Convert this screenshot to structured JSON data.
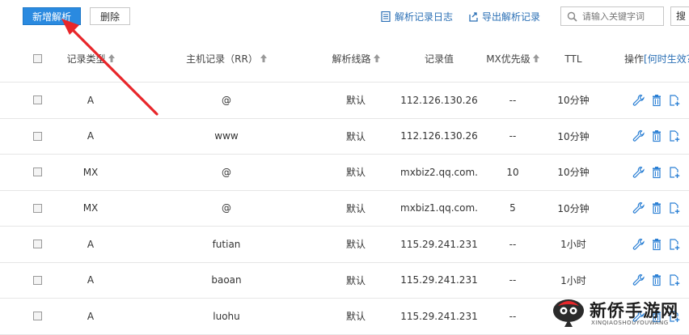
{
  "toolbar": {
    "add_label": "新增解析",
    "delete_label": "删除",
    "log_label": "解析记录日志",
    "export_label": "导出解析记录",
    "search_placeholder": "请输入关键字词",
    "search_button_label": "搜"
  },
  "table": {
    "headers": {
      "type": "记录类型",
      "rr": "主机记录（RR）",
      "line": "解析线路",
      "value": "记录值",
      "mx": "MX优先级",
      "ttl": "TTL",
      "op_prefix": "操作",
      "op_link": "[何时生效？"
    },
    "rows": [
      {
        "type": "A",
        "rr": "@",
        "line": "默认",
        "value": "112.126.130.26",
        "mx": "--",
        "ttl": "10分钟"
      },
      {
        "type": "A",
        "rr": "www",
        "line": "默认",
        "value": "112.126.130.26",
        "mx": "--",
        "ttl": "10分钟"
      },
      {
        "type": "MX",
        "rr": "@",
        "line": "默认",
        "value": "mxbiz2.qq.com.",
        "mx": "10",
        "ttl": "10分钟"
      },
      {
        "type": "MX",
        "rr": "@",
        "line": "默认",
        "value": "mxbiz1.qq.com.",
        "mx": "5",
        "ttl": "10分钟"
      },
      {
        "type": "A",
        "rr": "futian",
        "line": "默认",
        "value": "115.29.241.231",
        "mx": "--",
        "ttl": "1小时"
      },
      {
        "type": "A",
        "rr": "baoan",
        "line": "默认",
        "value": "115.29.241.231",
        "mx": "--",
        "ttl": "1小时"
      },
      {
        "type": "A",
        "rr": "luohu",
        "line": "默认",
        "value": "115.29.241.231",
        "mx": "--",
        "ttl": ""
      }
    ]
  },
  "icons": {
    "edit": "wrench-icon",
    "delete": "trash-icon",
    "copy": "copy-add-icon",
    "sort": "sort-arrow-icon",
    "search": "search-icon",
    "log": "log-list-icon",
    "export": "export-icon"
  },
  "colors": {
    "primary": "#2a8ae0",
    "link": "#2a6fb5",
    "annotation_arrow": "#e8262a"
  },
  "watermark": {
    "title": "新侨手游网",
    "subtitle": "XINQIAOSHOUYOUWANG"
  }
}
